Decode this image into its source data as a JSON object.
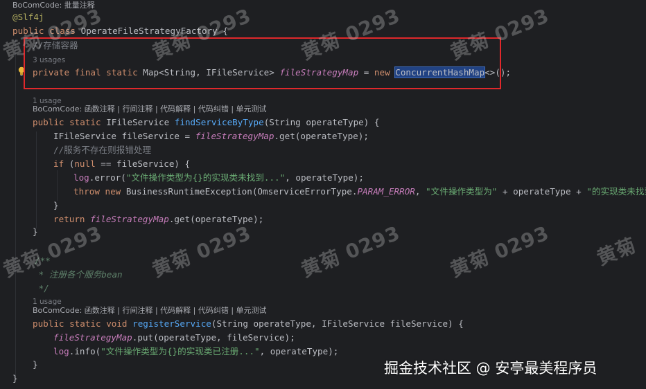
{
  "editor": {
    "language": "java",
    "theme": "dark",
    "header_hint": "BoCom​Code: 批量注释",
    "annotation": "@Slf4j",
    "class_decl": {
      "public": "public",
      "class": "class",
      "name": "OperateFileStrategyFactory",
      "brace": " {"
    },
    "comment_storage": "//存储容器",
    "usages_field": "3 usages",
    "field": {
      "private": "private",
      "final": "final",
      "static": "static",
      "type": "Map<String, IFileService>",
      "name": "fileStrategyMap",
      "eq": " = ",
      "new": "new",
      "impl": "ConcurrentHashMap",
      "tail": "<>();"
    },
    "usages_find": "1 usage",
    "bocom_actions": "BoCom​Code: 函数注释 | 行间注释 | 代码解释 | 代码纠错 | 单元测试",
    "find_method": {
      "public": "public",
      "static": "static",
      "ret": "IFileService",
      "name": "findServiceByType",
      "params": "(String operateType) {"
    },
    "find_line1": {
      "type": "IFileService fileService = ",
      "field": "fileStrategyMap",
      "rest": ".get(operateType);"
    },
    "comment_notfound": "//服务不存在则报错处理",
    "if_line": {
      "if": "if",
      "open": " (",
      "null": "null",
      "rest": " == fileService) {"
    },
    "log_error": {
      "log": "log",
      "call": ".error(",
      "str": "\"文件操作类型为{}的实现类未找到...\"",
      "rest": ", operateType);"
    },
    "throw_line": {
      "throw": "throw",
      "new": "new",
      "cls": " BusinessRuntimeException(OmserviceErrorType.",
      "const": "PARAM_ERROR",
      "sep": ", ",
      "str1": "\"文件操作类型为\"",
      "mid": " + operateType + ",
      "str2": "\"的实现类未找到\"",
      "end": ");"
    },
    "close_if": "}",
    "return_line": {
      "return": "return",
      "sp": " ",
      "field": "fileStrategyMap",
      "rest": ".get(operateType);"
    },
    "close_method": "}",
    "javadoc_open": "/**",
    "javadoc_text": " * 注册各个服务bean",
    "javadoc_close": " */",
    "usages_register": "1 usage",
    "register_method": {
      "public": "public",
      "static": "static",
      "void": "void",
      "name": "registerService",
      "params": "(String operateType, IFileService fileService) {"
    },
    "put_line": {
      "field": "fileStrategyMap",
      "rest": ".put(operateType, fileService);"
    },
    "log_info": {
      "log": "log",
      "call": ".info(",
      "str": "\"文件操作类型为{}的实现类已注册...\"",
      "rest": ", operateType);"
    },
    "close_class": "}"
  },
  "watermarks": {
    "author_mark": "黄菊 0293",
    "site_mark": "掘金技术社区 @ 安亭最美程序员"
  },
  "colors": {
    "background": "#1e1f22",
    "keyword": "#cf8e6d",
    "string": "#6aab73",
    "field": "#c77dbb",
    "method": "#56a8f5",
    "highlight_border": "#e0282b"
  }
}
